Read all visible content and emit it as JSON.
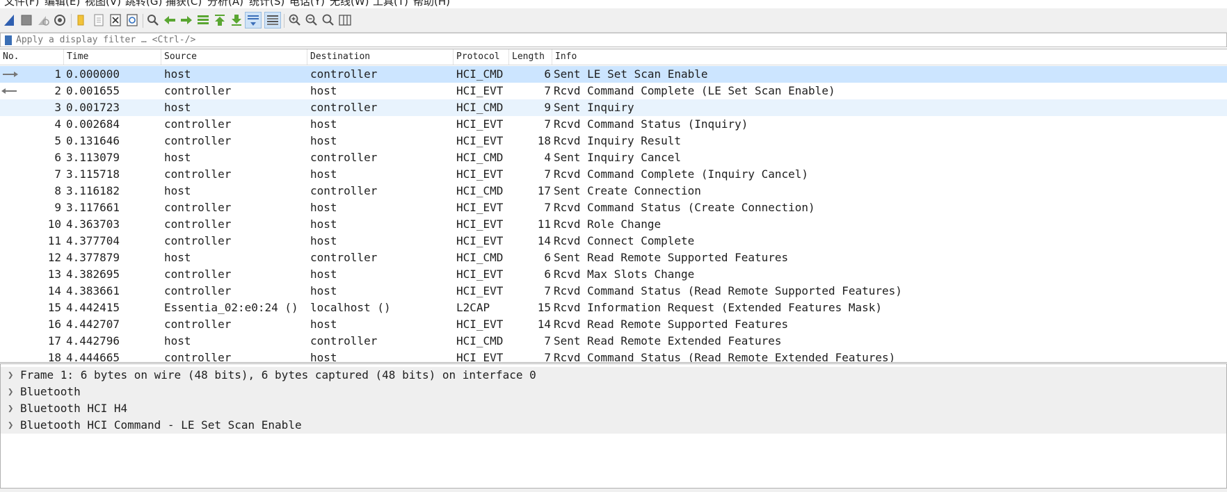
{
  "menu": [
    "文件(F)",
    "编辑(E)",
    "视图(V)",
    "跳转(G)",
    "捕获(C)",
    "分析(A)",
    "统计(S)",
    "电话(Y)",
    "无线(W)",
    "工具(T)",
    "帮助(H)"
  ],
  "filter": {
    "placeholder": "Apply a display filter … <Ctrl-/>"
  },
  "columns": {
    "no": "No.",
    "time": "Time",
    "source": "Source",
    "destination": "Destination",
    "protocol": "Protocol",
    "length": "Length",
    "info": "Info"
  },
  "packets": [
    {
      "no": "1",
      "time": "0.000000",
      "src": "host",
      "dst": "controller",
      "proto": "HCI_CMD",
      "len": "6",
      "info": "Sent LE Set Scan Enable"
    },
    {
      "no": "2",
      "time": "0.001655",
      "src": "controller",
      "dst": "host",
      "proto": "HCI_EVT",
      "len": "7",
      "info": "Rcvd Command Complete (LE Set Scan Enable)"
    },
    {
      "no": "3",
      "time": "0.001723",
      "src": "host",
      "dst": "controller",
      "proto": "HCI_CMD",
      "len": "9",
      "info": "Sent Inquiry"
    },
    {
      "no": "4",
      "time": "0.002684",
      "src": "controller",
      "dst": "host",
      "proto": "HCI_EVT",
      "len": "7",
      "info": "Rcvd Command Status (Inquiry)"
    },
    {
      "no": "5",
      "time": "0.131646",
      "src": "controller",
      "dst": "host",
      "proto": "HCI_EVT",
      "len": "18",
      "info": "Rcvd Inquiry Result"
    },
    {
      "no": "6",
      "time": "3.113079",
      "src": "host",
      "dst": "controller",
      "proto": "HCI_CMD",
      "len": "4",
      "info": "Sent Inquiry Cancel"
    },
    {
      "no": "7",
      "time": "3.115718",
      "src": "controller",
      "dst": "host",
      "proto": "HCI_EVT",
      "len": "7",
      "info": "Rcvd Command Complete (Inquiry Cancel)"
    },
    {
      "no": "8",
      "time": "3.116182",
      "src": "host",
      "dst": "controller",
      "proto": "HCI_CMD",
      "len": "17",
      "info": "Sent Create Connection"
    },
    {
      "no": "9",
      "time": "3.117661",
      "src": "controller",
      "dst": "host",
      "proto": "HCI_EVT",
      "len": "7",
      "info": "Rcvd Command Status (Create Connection)"
    },
    {
      "no": "10",
      "time": "4.363703",
      "src": "controller",
      "dst": "host",
      "proto": "HCI_EVT",
      "len": "11",
      "info": "Rcvd Role Change"
    },
    {
      "no": "11",
      "time": "4.377704",
      "src": "controller",
      "dst": "host",
      "proto": "HCI_EVT",
      "len": "14",
      "info": "Rcvd Connect Complete"
    },
    {
      "no": "12",
      "time": "4.377879",
      "src": "host",
      "dst": "controller",
      "proto": "HCI_CMD",
      "len": "6",
      "info": "Sent Read Remote Supported Features"
    },
    {
      "no": "13",
      "time": "4.382695",
      "src": "controller",
      "dst": "host",
      "proto": "HCI_EVT",
      "len": "6",
      "info": "Rcvd Max Slots Change"
    },
    {
      "no": "14",
      "time": "4.383661",
      "src": "controller",
      "dst": "host",
      "proto": "HCI_EVT",
      "len": "7",
      "info": "Rcvd Command Status (Read Remote Supported Features)"
    },
    {
      "no": "15",
      "time": "4.442415",
      "src": "Essentia_02:e0:24 ()",
      "dst": "localhost ()",
      "proto": "L2CAP",
      "len": "15",
      "info": "Rcvd Information Request (Extended Features Mask)"
    },
    {
      "no": "16",
      "time": "4.442707",
      "src": "controller",
      "dst": "host",
      "proto": "HCI_EVT",
      "len": "14",
      "info": "Rcvd Read Remote Supported Features"
    },
    {
      "no": "17",
      "time": "4.442796",
      "src": "host",
      "dst": "controller",
      "proto": "HCI_CMD",
      "len": "7",
      "info": "Sent Read Remote Extended Features"
    },
    {
      "no": "18",
      "time": "4.444665",
      "src": "controller",
      "dst": "host",
      "proto": "HCI_EVT",
      "len": "7",
      "info": "Rcvd Command Status (Read Remote Extended Features)"
    }
  ],
  "details": [
    "Frame 1: 6 bytes on wire (48 bits), 6 bytes captured (48 bits) on interface 0",
    "Bluetooth",
    "Bluetooth HCI H4",
    "Bluetooth HCI Command - LE Set Scan Enable"
  ],
  "toolbar_icons": [
    "shark-fin-start-icon",
    "stop-icon",
    "restart-icon",
    "capture-options-icon",
    "open-folder-icon",
    "file-icon",
    "close-file-icon",
    "reload-icon",
    "find-icon",
    "go-back-icon",
    "go-forward-icon",
    "go-to-packet-icon",
    "go-first-icon",
    "go-last-icon",
    "autoscroll-icon",
    "colorize-icon",
    "zoom-in-icon",
    "zoom-out-icon",
    "zoom-normal-icon",
    "resize-columns-icon"
  ]
}
